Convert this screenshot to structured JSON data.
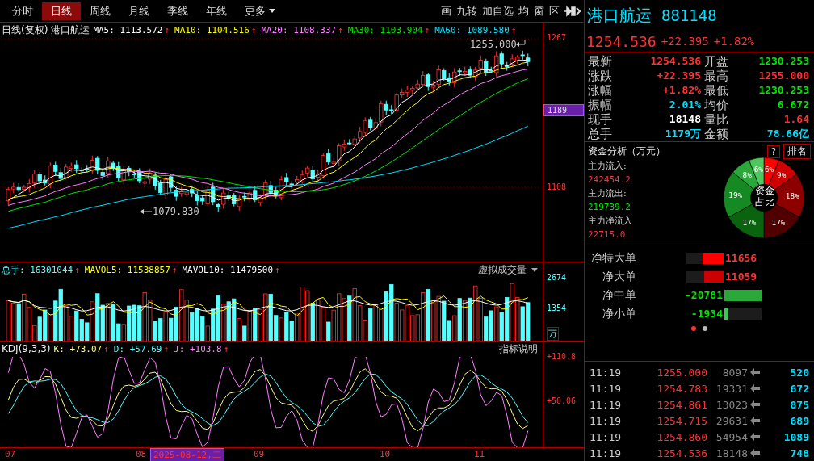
{
  "toolbar": {
    "tabs": [
      {
        "label": "分时",
        "selected": false,
        "dropdown": false
      },
      {
        "label": "日线",
        "selected": true,
        "dropdown": false
      },
      {
        "label": "周线",
        "selected": false,
        "dropdown": false
      },
      {
        "label": "月线",
        "selected": false,
        "dropdown": false
      },
      {
        "label": "季线",
        "selected": false,
        "dropdown": false
      },
      {
        "label": "年线",
        "selected": false,
        "dropdown": false
      },
      {
        "label": "更多",
        "selected": false,
        "dropdown": true
      }
    ],
    "tools": [
      "画",
      "九转",
      "加自选",
      "均",
      "窗",
      "区"
    ]
  },
  "chart": {
    "legend_title": "日线(复权)",
    "name": "港口航运",
    "ma": [
      {
        "label": "MA5:",
        "value": "1113.572",
        "arrow": "↑",
        "color": "#ffffff"
      },
      {
        "label": "MA10:",
        "value": "1104.516",
        "arrow": "↑",
        "color": "#ffff00"
      },
      {
        "label": "MA20:",
        "value": "1108.337",
        "arrow": "↑",
        "color": "#ff80ff"
      },
      {
        "label": "MA30:",
        "value": "1103.904",
        "arrow": "↑",
        "color": "#00e600"
      },
      {
        "label": "MA60:",
        "value": "1089.580",
        "arrow": "↑",
        "color": "#00e0ff"
      }
    ],
    "price_ticks": [
      "1267",
      "1108"
    ],
    "cursor_price": "1189",
    "high_label": "1255.000",
    "low_label": "1079.830"
  },
  "volume": {
    "legend": [
      {
        "label": "总手:",
        "value": "16301044",
        "arrow": "↑",
        "color": "#54ffff"
      },
      {
        "label": "MAVOL5:",
        "value": "11538857",
        "arrow": "↑",
        "color": "#ffff00"
      },
      {
        "label": "MAVOL10:",
        "value": "11479500",
        "arrow": "↑",
        "color": "#ffffff"
      }
    ],
    "mode": "虚拟成交量",
    "ticks": [
      "2674",
      "1354"
    ],
    "unit": "万"
  },
  "kdj": {
    "legend_title": "KDJ(9,3,3)",
    "lines": [
      {
        "label": "K:",
        "value": "+73.07",
        "arrow": "↑",
        "color": "#ffff80"
      },
      {
        "label": "D:",
        "value": "+57.69",
        "arrow": "↑",
        "color": "#54ffff"
      },
      {
        "label": "J:",
        "value": "+103.8",
        "arrow": "↑",
        "color": "#ff80ff"
      }
    ],
    "help": "指标说明",
    "ticks": [
      "+110.8",
      "+50.06"
    ]
  },
  "dates": {
    "ticks": [
      "07",
      "08",
      "09",
      "10",
      "11"
    ],
    "cursor_date": "2025-08-12,二"
  },
  "quote": {
    "name": "港口航运",
    "code": "881148",
    "price": "1254.536",
    "change": "+22.395",
    "pct": "+1.82%",
    "stats": [
      {
        "label": "最新",
        "value": "1254.536",
        "color": "#ff3232"
      },
      {
        "label": "开盘",
        "value": "1230.253",
        "color": "#00e600"
      },
      {
        "label": "涨跌",
        "value": "+22.395",
        "color": "#ff3232"
      },
      {
        "label": "最高",
        "value": "1255.000",
        "color": "#ff3232"
      },
      {
        "label": "涨幅",
        "value": "+1.82%",
        "color": "#ff3232"
      },
      {
        "label": "最低",
        "value": "1230.253",
        "color": "#00e600"
      },
      {
        "label": "振幅",
        "value": "2.01%",
        "color": "#00e0ff"
      },
      {
        "label": "均价",
        "value": "6.672",
        "color": "#00e600"
      },
      {
        "label": "现手",
        "value": "18148",
        "color": "#ffffff"
      },
      {
        "label": "量比",
        "value": "1.64",
        "color": "#ff3232"
      },
      {
        "label": "总手",
        "value": "1179万",
        "color": "#00e0ff"
      },
      {
        "label": "金额",
        "value": "78.66亿",
        "color": "#00e0ff"
      }
    ]
  },
  "fund": {
    "title": "资金分析（万元）",
    "help": "?",
    "rank": "排名",
    "flows": [
      {
        "label": "主力流入:",
        "value": "242454.2",
        "color": "#ff3232"
      },
      {
        "label": "主力流出:",
        "value": "219739.2",
        "color": "#00e600"
      },
      {
        "label": "主力净流入",
        "value": "22715.0",
        "color": "#ff3232"
      }
    ],
    "chart_data": {
      "type": "donut",
      "values": [
        6,
        9,
        18,
        17,
        17,
        19,
        8,
        6
      ],
      "value_labels": [
        "6%",
        "9%",
        "18%",
        "17%",
        "17%",
        "19%",
        "8%",
        "6%"
      ],
      "colors": [
        "#ff0000",
        "#d00000",
        "#8c0000",
        "#500000",
        "#0a640f",
        "#168a22",
        "#2aa83a",
        "#4cc85c"
      ]
    },
    "pie_center": "资金占比",
    "net": [
      {
        "label": "净特大单",
        "value": "11656",
        "kind": "inflow",
        "level": 0.56,
        "color": "#ff0000"
      },
      {
        "label": "净大单",
        "value": "11059",
        "kind": "inflow",
        "level": 0.53,
        "color": "#cc0000"
      },
      {
        "label": "净中单",
        "value": "-20781",
        "kind": "outflow",
        "level": 1.0,
        "color": "#2aa83a"
      },
      {
        "label": "净小单",
        "value": "-1934",
        "kind": "outflow",
        "level": 0.09,
        "color": "#3cc850"
      }
    ],
    "pages": [
      {
        "selected": true
      },
      {
        "selected": false
      }
    ]
  },
  "trades": [
    {
      "time": "11:19",
      "price": "1255.000",
      "volume": "8097",
      "count": "520"
    },
    {
      "time": "11:19",
      "price": "1254.783",
      "volume": "19331",
      "count": "672"
    },
    {
      "time": "11:19",
      "price": "1254.861",
      "volume": "13023",
      "count": "875"
    },
    {
      "time": "11:19",
      "price": "1254.715",
      "volume": "29631",
      "count": "689"
    },
    {
      "time": "11:19",
      "price": "1254.860",
      "volume": "54954",
      "count": "1089"
    },
    {
      "time": "11:19",
      "price": "1254.536",
      "volume": "18148",
      "count": "748"
    }
  ]
}
